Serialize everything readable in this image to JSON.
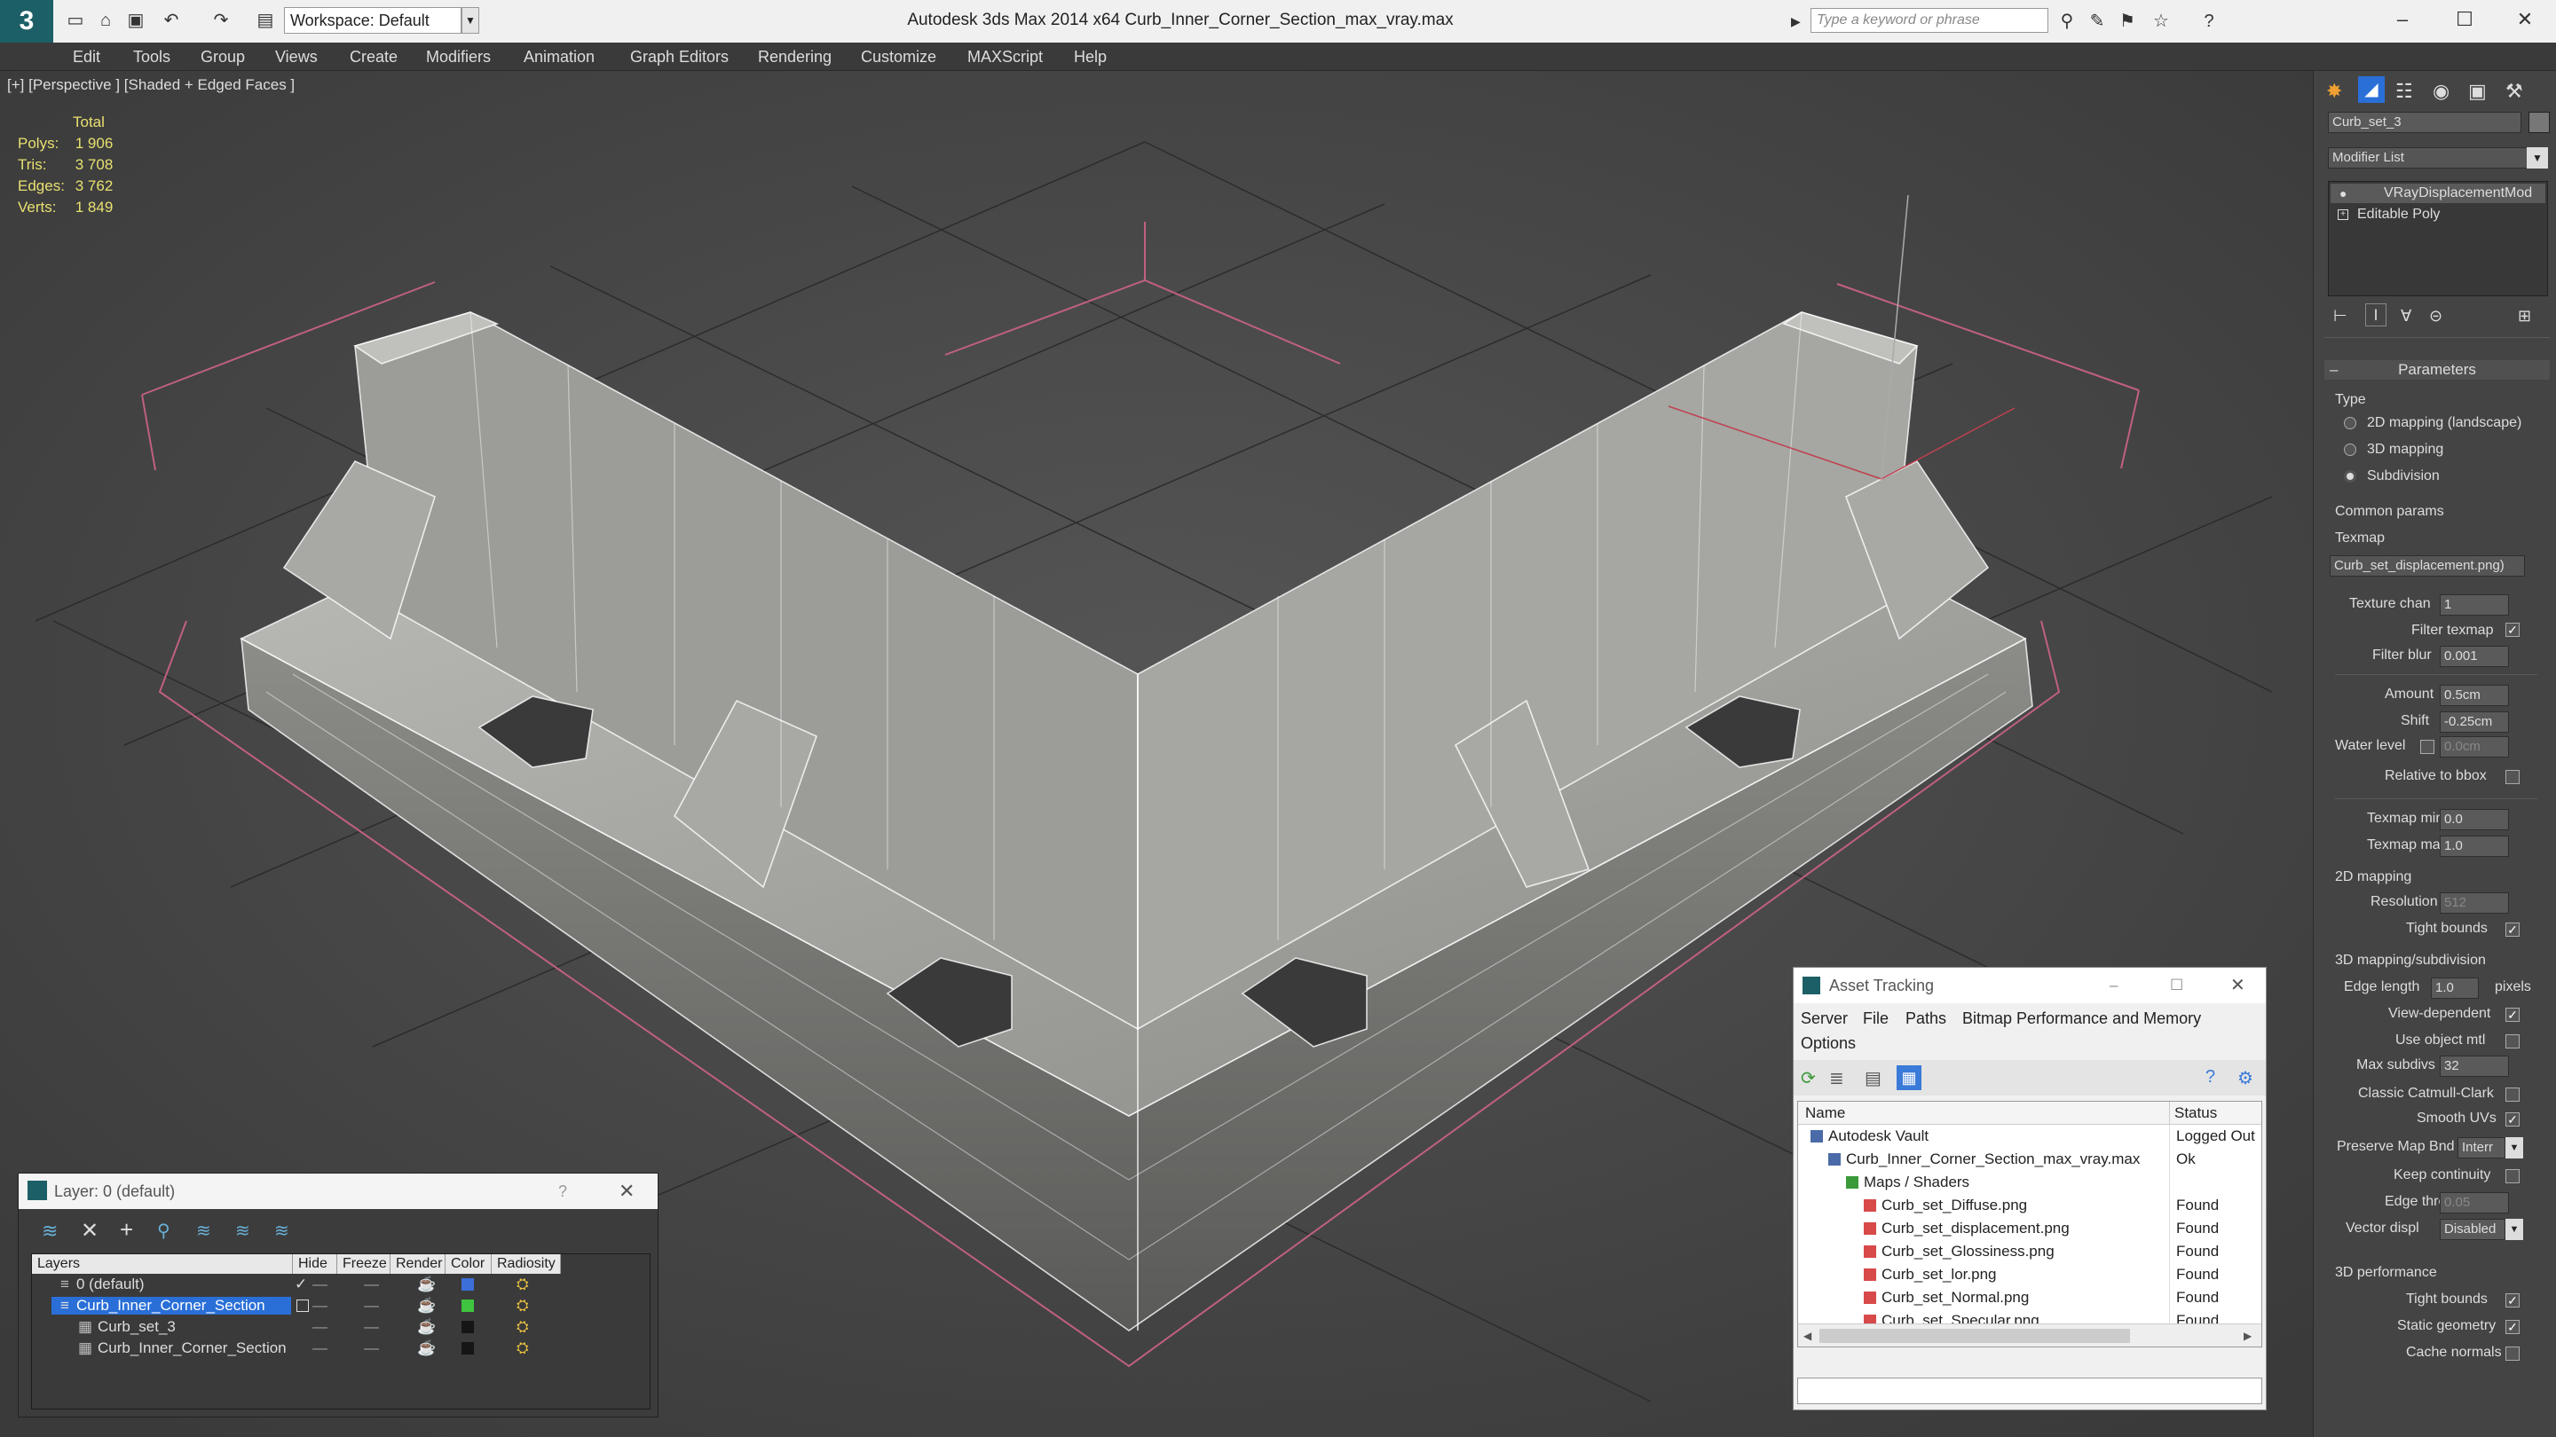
{
  "titlebar": {
    "workspace": "Workspace: Default",
    "title": "Autodesk 3ds Max  2014 x64     Curb_Inner_Corner_Section_max_vray.max",
    "search_placeholder": "Type a keyword or phrase"
  },
  "menu": [
    "Edit",
    "Tools",
    "Group",
    "Views",
    "Create",
    "Modifiers",
    "Animation",
    "Graph Editors",
    "Rendering",
    "Customize",
    "MAXScript",
    "Help"
  ],
  "viewport": {
    "label": "[+] [Perspective ] [Shaded + Edged Faces ]",
    "stats_title": "Total",
    "stats": [
      {
        "k": "Polys:",
        "v": "1 906"
      },
      {
        "k": "Tris:",
        "v": "3 708"
      },
      {
        "k": "Edges:",
        "v": "3 762"
      },
      {
        "k": "Verts:",
        "v": "1 849"
      }
    ]
  },
  "layer": {
    "title": "Layer: 0 (default)",
    "help": "?",
    "columns": [
      "Layers",
      "Hide",
      "Freeze",
      "Render",
      "Color",
      "Radiosity"
    ],
    "rows": [
      {
        "name": "0 (default)",
        "color": "#3c6fd8"
      },
      {
        "name": "Curb_Inner_Corner_Section",
        "color": "#3fc43f",
        "selected": true
      },
      {
        "name": "Curb_set_3",
        "color": "#151515"
      },
      {
        "name": "Curb_Inner_Corner_Section",
        "color": "#151515"
      }
    ]
  },
  "asset": {
    "title": "Asset Tracking",
    "menu1": [
      "Server",
      "File",
      "Paths",
      "Bitmap Performance and Memory"
    ],
    "menu2": "Options",
    "col_name": "Name",
    "col_status": "Status",
    "rows": [
      {
        "name": "Autodesk Vault",
        "status": "Logged Out",
        "indent": 0
      },
      {
        "name": "Curb_Inner_Corner_Section_max_vray.max",
        "status": "Ok",
        "indent": 1
      },
      {
        "name": "Maps / Shaders",
        "status": "",
        "indent": 2
      },
      {
        "name": "Curb_set_Diffuse.png",
        "status": "Found",
        "indent": 3
      },
      {
        "name": "Curb_set_displacement.png",
        "status": "Found",
        "indent": 3
      },
      {
        "name": "Curb_set_Glossiness.png",
        "status": "Found",
        "indent": 3
      },
      {
        "name": "Curb_set_lor.png",
        "status": "Found",
        "indent": 3
      },
      {
        "name": "Curb_set_Normal.png",
        "status": "Found",
        "indent": 3
      },
      {
        "name": "Curb_set_Specular.png",
        "status": "Found",
        "indent": 3
      }
    ]
  },
  "cmd": {
    "object_name": "Curb_set_3",
    "modifier_list": "Modifier List",
    "stack": [
      "VRayDisplacementMod",
      "Editable Poly"
    ],
    "rollout": "Parameters",
    "type_label": "Type",
    "types": [
      "2D mapping (landscape)",
      "3D mapping",
      "Subdivision"
    ],
    "common": "Common params",
    "texmap": "Texmap",
    "texmap_value": "Curb_set_displacement.png)",
    "tex_chan": "Texture chan",
    "tex_chan_v": "1",
    "filter_texmap": "Filter texmap",
    "filter_blur": "Filter blur",
    "filter_blur_v": "0.001",
    "amount": "Amount",
    "amount_v": "0.5cm",
    "shift": "Shift",
    "shift_v": "-0.25cm",
    "water": "Water level",
    "water_v": "0.0cm",
    "relative": "Relative to bbox",
    "tmin": "Texmap min",
    "tmin_v": "0.0",
    "tmax": "Texmap max",
    "tmax_v": "1.0",
    "map2d": "2D mapping",
    "resolution": "Resolution",
    "resolution_v": "512",
    "tight": "Tight bounds",
    "map3d": "3D mapping/subdivision",
    "edge_len": "Edge length",
    "edge_len_v": "1.0",
    "pixels": "pixels",
    "view_dep": "View-dependent",
    "use_obj": "Use object mtl",
    "max_sub": "Max subdivs",
    "max_sub_v": "32",
    "catmull": "Classic Catmull-Clark",
    "smooth": "Smooth UVs",
    "preserve": "Preserve Map Bnd",
    "preserve_v": "Interr",
    "keep": "Keep continuity",
    "edge_thresh": "Edge thresh",
    "edge_thresh_v": "0.05",
    "vector": "Vector displ",
    "vector_v": "Disabled",
    "perf": "3D performance",
    "tight2": "Tight bounds",
    "static": "Static geometry",
    "cache": "Cache normals"
  }
}
